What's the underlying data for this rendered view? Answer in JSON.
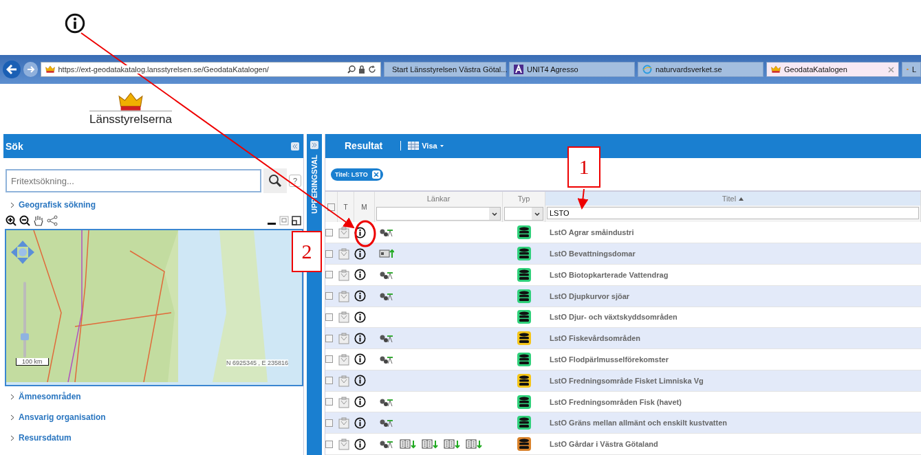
{
  "browser": {
    "address": "https://ext-geodatakatalog.lansstyrelsen.se/GeodataKatalogen/",
    "tabs": [
      {
        "label": "Start Länsstyrelsen Västra Götal...",
        "kind": "sharepoint",
        "selected": false
      },
      {
        "label": "UNIT4 Agresso",
        "kind": "agresso",
        "selected": false
      },
      {
        "label": "naturvardsverket.se",
        "kind": "globe",
        "selected": false
      },
      {
        "label": "GeodataKatalogen",
        "kind": "crown",
        "selected": true
      },
      {
        "label": "L",
        "kind": "crown",
        "selected": false
      }
    ]
  },
  "logo": {
    "text": "Länsstyrelserna"
  },
  "search_panel": {
    "title": "Sök",
    "search": {
      "placeholder": "Fritextsökning..."
    },
    "help": "?",
    "top_sections": [
      {
        "label": "Geografisk sökning"
      }
    ],
    "map": {
      "zoom": {
        "level": 0.25
      },
      "scale": "100 km",
      "coordinates": "N 6925345 , E 235816"
    },
    "sections": [
      {
        "label": "Ämnesområden"
      },
      {
        "label": "Ansvarig organisation"
      },
      {
        "label": "Resursdatum"
      }
    ]
  },
  "grouping_strip": {
    "label": "UPPERINGSVAL"
  },
  "results": {
    "title": "Resultat",
    "view_button": "Visa",
    "filter_chips": [
      {
        "label": "Titel: LSTO"
      }
    ],
    "columns": [
      {
        "label": "T",
        "sorted": false
      },
      {
        "label": "M",
        "sorted": false
      },
      {
        "label": "Länkar",
        "sorted": false
      },
      {
        "label": "Typ",
        "sorted": false
      },
      {
        "label": "Titel",
        "sorted": true
      }
    ],
    "title_filter": {
      "value": "LSTO"
    },
    "select_all": {
      "checked": false
    },
    "rows": [
      {
        "checked": false,
        "links": [
          {
            "kind": "gears"
          }
        ],
        "color": "#2fd07a",
        "title": "LstO Agrar småindustri"
      },
      {
        "checked": false,
        "links": [
          {
            "kind": "card"
          }
        ],
        "color": "#2fd07a",
        "title": "LstO Bevattningsdomar"
      },
      {
        "checked": false,
        "links": [
          {
            "kind": "gears"
          }
        ],
        "color": "#2fd07a",
        "title": "LstO Biotopkarterade Vattendrag"
      },
      {
        "checked": false,
        "links": [
          {
            "kind": "gears"
          }
        ],
        "color": "#2fd07a",
        "title": "LstO Djupkurvor sjöar"
      },
      {
        "checked": false,
        "links": [],
        "color": "#2fd07a",
        "title": "LstO Djur- och växtskyddsområden"
      },
      {
        "checked": false,
        "links": [
          {
            "kind": "gears"
          }
        ],
        "color": "#f5c518",
        "title": "LstO Fiskevårdsområden"
      },
      {
        "checked": false,
        "links": [
          {
            "kind": "gears"
          }
        ],
        "color": "#2fd07a",
        "title": "LstO Flodpärlmusselförekomster"
      },
      {
        "checked": false,
        "links": [],
        "color": "#f5c518",
        "title": "LstO Fredningsområde Fisket Limniska Vg"
      },
      {
        "checked": false,
        "links": [
          {
            "kind": "gears"
          }
        ],
        "color": "#2fd07a",
        "title": "LstO Fredningsområden Fisk (havet)"
      },
      {
        "checked": false,
        "links": [
          {
            "kind": "gears"
          }
        ],
        "color": "#2fd07a",
        "title": "LstO Gräns mellan allmänt och enskilt kustvatten"
      },
      {
        "checked": false,
        "links": [
          {
            "kind": "gears"
          },
          {
            "kind": "book"
          },
          {
            "kind": "book"
          },
          {
            "kind": "book"
          },
          {
            "kind": "book"
          }
        ],
        "color": "#d9822b",
        "title": "LstO Gårdar i Västra Götaland"
      }
    ]
  },
  "annotations": {
    "callouts": [
      {
        "label": "1"
      },
      {
        "label": "2"
      }
    ]
  }
}
